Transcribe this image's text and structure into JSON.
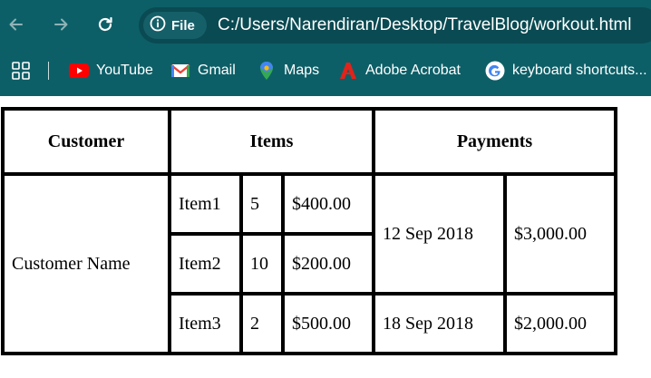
{
  "browser": {
    "site_chip": "File",
    "url": "C:/Users/Narendiran/Desktop/TravelBlog/workout.html",
    "bookmarks": [
      {
        "label": "YouTube",
        "icon": "youtube-icon"
      },
      {
        "label": "Gmail",
        "icon": "gmail-icon"
      },
      {
        "label": "Maps",
        "icon": "maps-icon"
      },
      {
        "label": "Adobe Acrobat",
        "icon": "adobe-acrobat-icon"
      },
      {
        "label": "keyboard shortcuts...",
        "icon": "google-icon"
      }
    ]
  },
  "table": {
    "headers": {
      "customer": "Customer",
      "items": "Items",
      "payments": "Payments"
    },
    "customer_name": "Customer Name",
    "rows": [
      {
        "item": "Item1",
        "qty": "5",
        "price": "$400.00"
      },
      {
        "item": "Item2",
        "qty": "10",
        "price": "$200.00"
      },
      {
        "item": "Item3",
        "qty": "2",
        "price": "$500.00"
      }
    ],
    "payments": [
      {
        "date": "12 Sep 2018",
        "amount": "$3,000.00"
      },
      {
        "date": "18 Sep 2018",
        "amount": "$2,000.00"
      }
    ]
  },
  "colors": {
    "toolbar": "#0d5f67",
    "omnibox": "#0a4a52",
    "border": "#000000"
  }
}
